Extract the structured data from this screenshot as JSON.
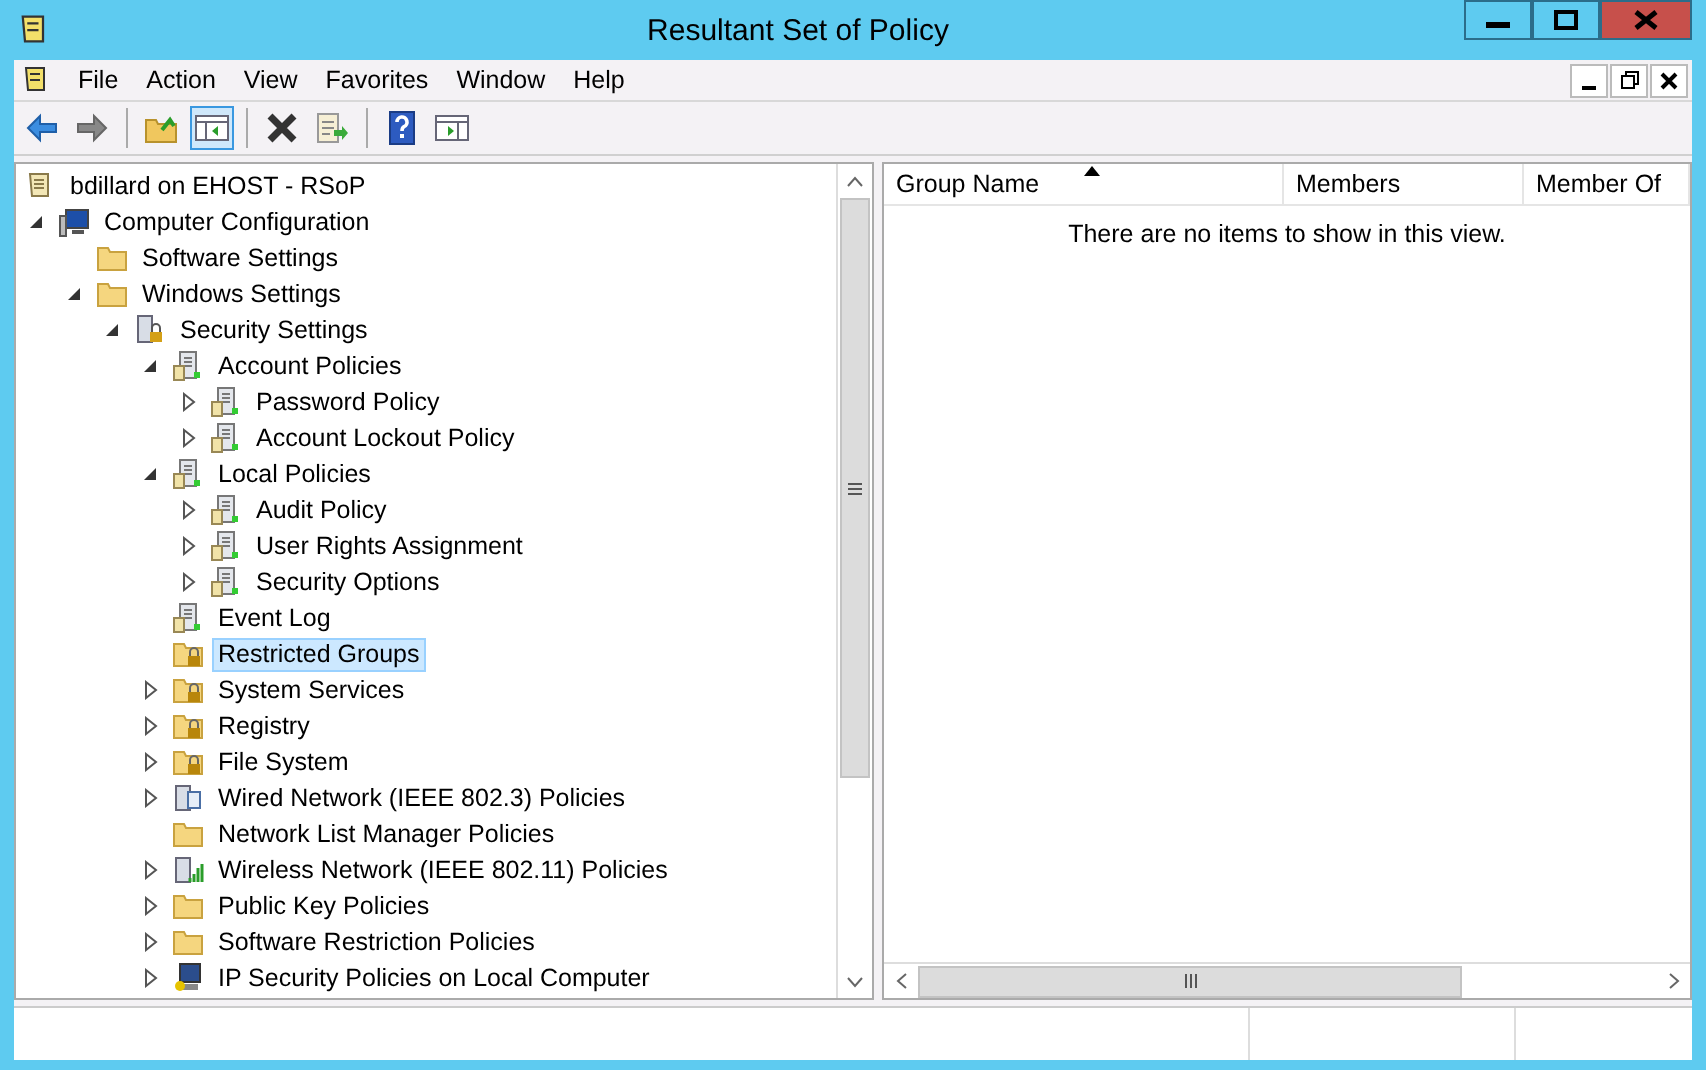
{
  "window": {
    "title": "Resultant Set of Policy"
  },
  "menu": [
    "File",
    "Action",
    "View",
    "Favorites",
    "Window",
    "Help"
  ],
  "toolbar": [
    {
      "kind": "back",
      "pressed": false
    },
    {
      "kind": "forward",
      "pressed": false
    },
    {
      "kind": "separator"
    },
    {
      "kind": "up",
      "pressed": false
    },
    {
      "kind": "tree",
      "pressed": true
    },
    {
      "kind": "separator"
    },
    {
      "kind": "delete",
      "pressed": false
    },
    {
      "kind": "export",
      "pressed": false
    },
    {
      "kind": "separator"
    },
    {
      "kind": "help",
      "pressed": false
    },
    {
      "kind": "pane",
      "pressed": false
    }
  ],
  "tree": [
    {
      "label": "bdillard on EHOST - RSoP",
      "kind": "doc",
      "selected": false,
      "children": [
        {
          "label": "Computer Configuration",
          "kind": "computer",
          "expanded": true,
          "selected": false,
          "children": [
            {
              "label": "Software Settings",
              "kind": "folder",
              "selected": false
            },
            {
              "label": "Windows Settings",
              "kind": "folder",
              "expanded": true,
              "selected": false,
              "children": [
                {
                  "label": "Security Settings",
                  "kind": "secure",
                  "expanded": true,
                  "selected": false,
                  "children": [
                    {
                      "label": "Account Policies",
                      "kind": "policy",
                      "expanded": true,
                      "selected": false,
                      "children": [
                        {
                          "label": "Password Policy",
                          "kind": "policy",
                          "expanded": false,
                          "selected": false
                        },
                        {
                          "label": "Account Lockout Policy",
                          "kind": "policy",
                          "expanded": false,
                          "selected": false
                        }
                      ]
                    },
                    {
                      "label": "Local Policies",
                      "kind": "policy",
                      "expanded": true,
                      "selected": false,
                      "children": [
                        {
                          "label": "Audit Policy",
                          "kind": "policy",
                          "expanded": false,
                          "selected": false
                        },
                        {
                          "label": "User Rights Assignment",
                          "kind": "policy",
                          "expanded": false,
                          "selected": false
                        },
                        {
                          "label": "Security Options",
                          "kind": "policy",
                          "expanded": false,
                          "selected": false
                        }
                      ]
                    },
                    {
                      "label": "Event Log",
                      "kind": "policy",
                      "selected": false
                    },
                    {
                      "label": "Restricted Groups",
                      "kind": "lockfolder",
                      "selected": true
                    },
                    {
                      "label": "System Services",
                      "kind": "lockfolder",
                      "expanded": false,
                      "selected": false
                    },
                    {
                      "label": "Registry",
                      "kind": "lockfolder",
                      "expanded": false,
                      "selected": false
                    },
                    {
                      "label": "File System",
                      "kind": "lockfolder",
                      "expanded": false,
                      "selected": false
                    },
                    {
                      "label": "Wired Network (IEEE 802.3) Policies",
                      "kind": "network",
                      "expanded": false,
                      "selected": false
                    },
                    {
                      "label": "Network List Manager Policies",
                      "kind": "folder",
                      "selected": false
                    },
                    {
                      "label": "Wireless Network (IEEE 802.11) Policies",
                      "kind": "wireless",
                      "expanded": false,
                      "selected": false
                    },
                    {
                      "label": "Public Key Policies",
                      "kind": "folder",
                      "expanded": false,
                      "selected": false
                    },
                    {
                      "label": "Software Restriction Policies",
                      "kind": "folder",
                      "expanded": false,
                      "selected": false
                    },
                    {
                      "label": "IP Security Policies on Local Computer",
                      "kind": "ipsec",
                      "expanded": false,
                      "selected": false
                    }
                  ]
                }
              ]
            }
          ]
        }
      ]
    }
  ],
  "list": {
    "columns": [
      {
        "label": "Group Name",
        "sorted": true
      },
      {
        "label": "Members",
        "sorted": false
      },
      {
        "label": "Member Of",
        "sorted": false
      }
    ],
    "empty_message": "There are no items to show in this view."
  }
}
